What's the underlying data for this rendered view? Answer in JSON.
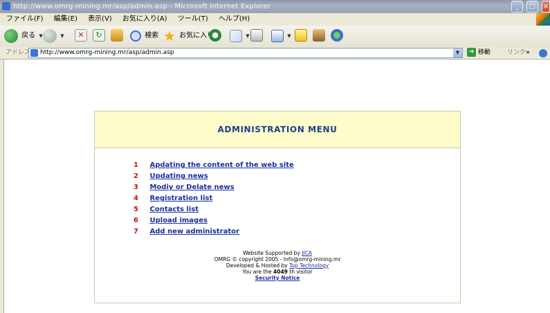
{
  "window": {
    "title": "http://www.omrg-mining.mr/asp/admin.asp - Microsoft Internet Explorer",
    "controls": [
      "_",
      "□",
      "×"
    ]
  },
  "menubar": {
    "items": [
      "ファイル(F)",
      "編集(E)",
      "表示(V)",
      "お気に入り(A)",
      "ツール(T)",
      "ヘルプ(H)"
    ]
  },
  "toolbar": {
    "back_label": "戻る",
    "search_label": "検索",
    "favorites_label": "お気に入り"
  },
  "addressbar": {
    "label": "アドレス(D)",
    "url": "http://www.omrg-mining.mr/asp/admin.asp",
    "go_label": "移動",
    "links_label": "リンク",
    "chevron": "»"
  },
  "admin": {
    "title": "ADMINISTRATION MENU",
    "items": [
      {
        "num": "1",
        "label": "Apdating the content of the web site"
      },
      {
        "num": "2",
        "label": "Updating news"
      },
      {
        "num": "3",
        "label": "Modiy or Delate news"
      },
      {
        "num": "4",
        "label": "Registration list"
      },
      {
        "num": "5",
        "label": "Contacts list"
      },
      {
        "num": "6",
        "label": "Upload images"
      },
      {
        "num": "7",
        "label": "Add new administrator"
      }
    ]
  },
  "footer": {
    "supported_prefix": "Website Supported by ",
    "supported_link": "JICA",
    "copyright": "OMRG © copyright 2005 - Info@omrg-mining.mr",
    "hosted_prefix": "Developed & Hosted by ",
    "hosted_link": "Top Technology",
    "visitor_prefix": "You are the ",
    "visitor_count": "4049",
    "visitor_suffix": " th visitor",
    "security_link": "Security Notice"
  },
  "colors": {
    "header_bg": "#fffccc",
    "title_color": "#1f3f8a",
    "number_color": "#c01818",
    "link_color": "#1a2f9a"
  }
}
